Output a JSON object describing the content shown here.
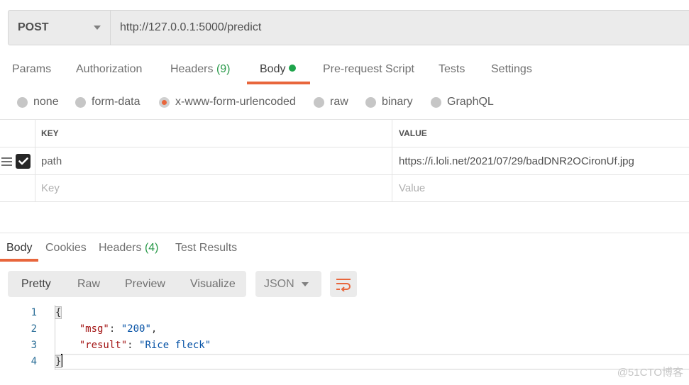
{
  "request": {
    "method": "POST",
    "url": "http://127.0.0.1:5000/predict"
  },
  "request_tabs": [
    {
      "label": "Params"
    },
    {
      "label": "Authorization"
    },
    {
      "label": "Headers",
      "count": "(9)"
    },
    {
      "label": "Body",
      "active": true,
      "indicator": "green-dot"
    },
    {
      "label": "Pre-request Script"
    },
    {
      "label": "Tests"
    },
    {
      "label": "Settings"
    }
  ],
  "body_types": [
    {
      "label": "none"
    },
    {
      "label": "form-data"
    },
    {
      "label": "x-www-form-urlencoded",
      "selected": true
    },
    {
      "label": "raw"
    },
    {
      "label": "binary"
    },
    {
      "label": "GraphQL"
    }
  ],
  "params_table": {
    "headers": {
      "key": "KEY",
      "value": "VALUE"
    },
    "rows": [
      {
        "checked": true,
        "key": "path",
        "value": "https://i.loli.net/2021/07/29/badDNR2OCironUf.jpg"
      }
    ],
    "new_row": {
      "key_placeholder": "Key",
      "value_placeholder": "Value"
    }
  },
  "response_tabs": [
    {
      "label": "Body",
      "active": true
    },
    {
      "label": "Cookies"
    },
    {
      "label": "Headers",
      "count": "(4)"
    },
    {
      "label": "Test Results"
    }
  ],
  "view_modes": [
    {
      "label": "Pretty",
      "active": true
    },
    {
      "label": "Raw"
    },
    {
      "label": "Preview"
    },
    {
      "label": "Visualize"
    }
  ],
  "format": "JSON",
  "response_body": {
    "line_numbers": [
      "1",
      "2",
      "3",
      "4"
    ],
    "open_brace": "{",
    "close_brace": "}",
    "msg_key": "\"msg\"",
    "msg_value": "\"200\"",
    "result_key": "\"result\"",
    "result_value": "\"Rice fleck\""
  },
  "colors": {
    "accent": "#e8663c",
    "count_green": "#2a9a4a",
    "body_dot": "#1ea44b"
  },
  "watermark": "@51CTO博客"
}
